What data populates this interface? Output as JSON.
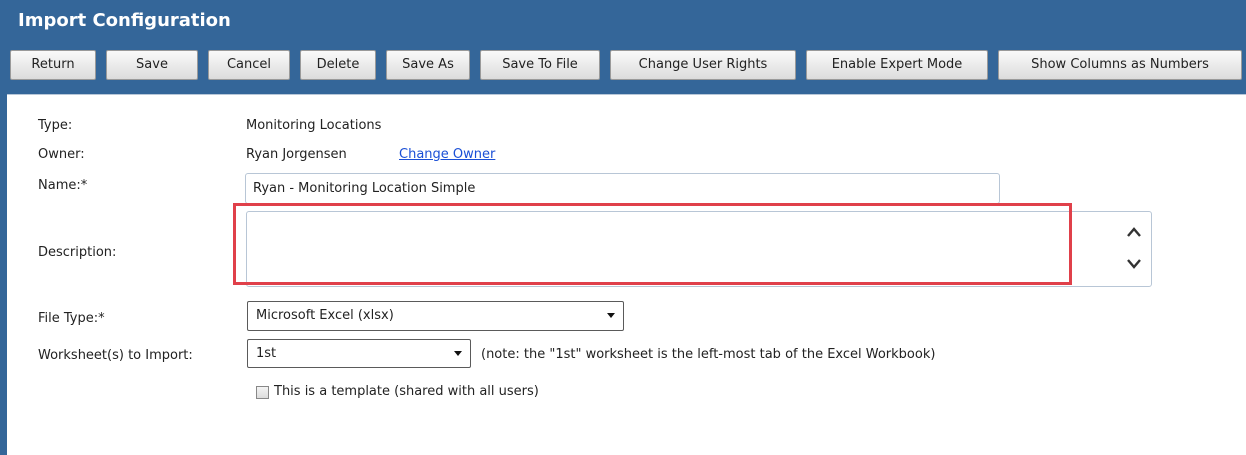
{
  "window": {
    "title": "Import Configuration"
  },
  "toolbar": {
    "buttons": [
      {
        "label": "Return"
      },
      {
        "label": "Save"
      },
      {
        "label": "Cancel"
      },
      {
        "label": "Delete"
      },
      {
        "label": "Save As"
      },
      {
        "label": "Save To File"
      },
      {
        "label": "Change User Rights"
      },
      {
        "label": "Enable Expert Mode"
      },
      {
        "label": "Show Columns as Numbers"
      }
    ]
  },
  "form": {
    "type_label": "Type:",
    "type_value": "Monitoring Locations",
    "owner_label": "Owner:",
    "owner_value": "Ryan Jorgensen",
    "change_owner_link": "Change Owner",
    "name_label": "Name:*",
    "name_value": "Ryan - Monitoring Location Simple",
    "description_label": "Description:",
    "description_value": "",
    "file_type_label": "File Type:*",
    "file_type_value": "Microsoft Excel (xlsx)",
    "worksheet_label": "Worksheet(s) to Import:",
    "worksheet_value": "1st",
    "worksheet_note": "(note: the \"1st\" worksheet is the left-most tab of the Excel Workbook)",
    "template_checkbox_label": "This is a template (shared with all users)",
    "template_checked": false
  },
  "colors": {
    "header_bg": "#346699",
    "highlight_border": "#e0404a",
    "link": "#1a4fd6"
  }
}
